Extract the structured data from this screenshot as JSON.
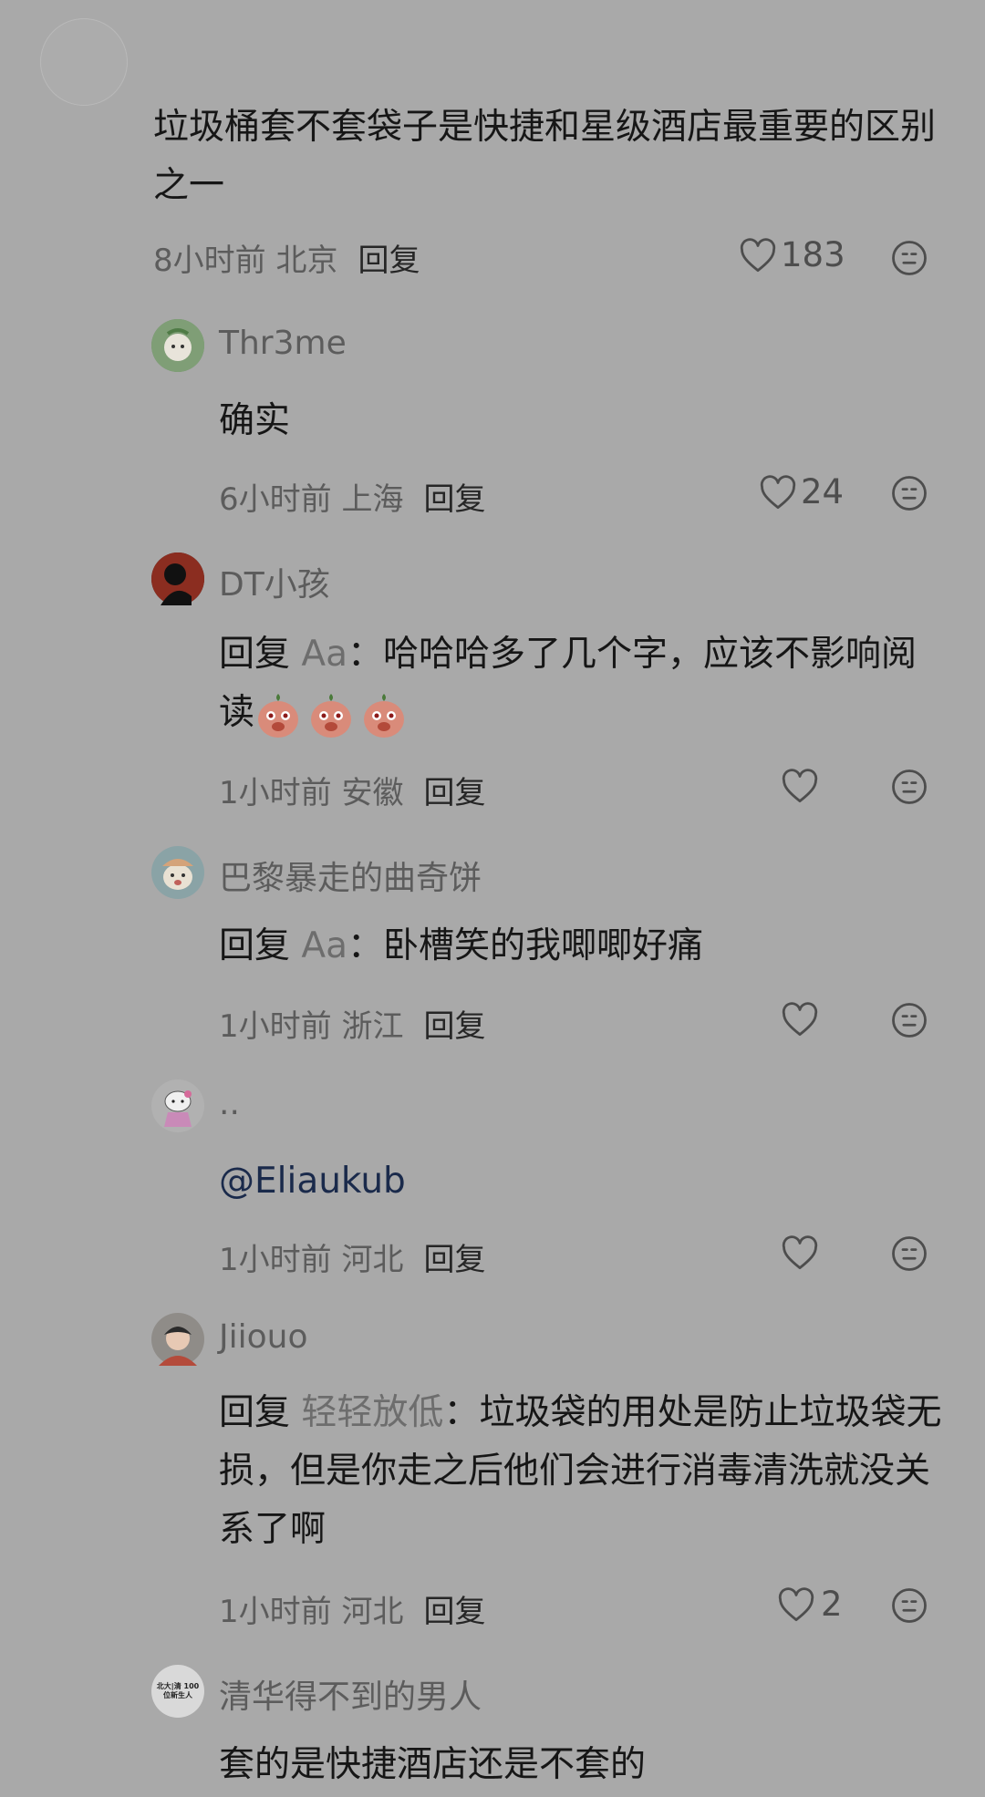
{
  "main_comment": {
    "text": "垃圾桶套不套袋子是快捷和星级酒店最重要的区别之一",
    "meta": "8小时前 北京",
    "reply_label": "回复",
    "likes": "183"
  },
  "replies": [
    {
      "username": "Thr3me",
      "text": "确实",
      "meta": "6小时前 上海",
      "reply_label": "回复",
      "likes": "24"
    },
    {
      "username": "DT小孩",
      "reply_prefix": "回复",
      "reply_target": "Aa",
      "text": "：哈哈哈多了几个字，应该不影响阅读",
      "meta": "1小时前 安徽",
      "reply_label": "回复",
      "likes": ""
    },
    {
      "username": "巴黎暴走的曲奇饼",
      "reply_prefix": "回复",
      "reply_target": "Aa",
      "text": "：卧槽笑的我唧唧好痛",
      "meta": "1小时前 浙江",
      "reply_label": "回复",
      "likes": ""
    },
    {
      "username": "..",
      "text": "@Eliaukub",
      "meta": "1小时前 河北",
      "reply_label": "回复",
      "likes": ""
    },
    {
      "username": "Jiiouo",
      "reply_prefix": "回复",
      "reply_target": "轻轻放低",
      "text": "：垃圾袋的用处是防止垃圾袋无损，但是你走之后他们会进行消毒清洗就没关系了啊",
      "meta": "1小时前 河北",
      "reply_label": "回复",
      "likes": "2"
    },
    {
      "username": "清华得不到的男人",
      "avatar_text": "北大|清 100位新生人",
      "text": "套的是快捷酒店还是不套的"
    }
  ],
  "icons": {
    "like": "heart-outline-icon",
    "emoji": "smiley-face-icon"
  },
  "colors": {
    "overlay_gray": "#a9a9a9",
    "mention": "#1a2a4b"
  }
}
